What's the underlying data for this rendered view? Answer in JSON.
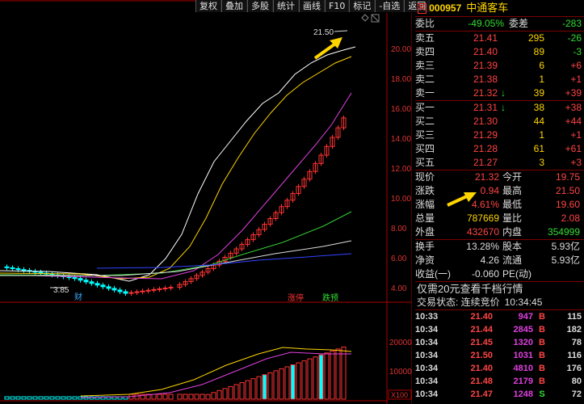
{
  "toolbar": {
    "buttons": [
      "复权",
      "叠加",
      "多股",
      "统计",
      "画线",
      "F10",
      "标记",
      "-自选",
      "返回"
    ]
  },
  "stock": {
    "badge": "R",
    "code": "000957",
    "name": "中通客车"
  },
  "chart": {
    "price_ticks": [
      "20.00",
      "18.00",
      "16.00",
      "14.00",
      "12.00",
      "10.00",
      "8.00",
      "6.00",
      "4.00"
    ],
    "volume_ticks": [
      "20000",
      "10000"
    ],
    "volume_unit": "X100",
    "high_label": "21.50",
    "low_label": "3.85",
    "marker_cai": "财",
    "marker_zhangting": "涨停",
    "marker_diefu": "跌预"
  },
  "quote": {
    "weibi": {
      "label": "委比",
      "value": "-49.05%",
      "label2": "委差",
      "value2": "-283"
    },
    "sells": [
      {
        "label": "卖五",
        "price": "21.41",
        "vol": "295",
        "chg": "-26"
      },
      {
        "label": "卖四",
        "price": "21.40",
        "vol": "89",
        "chg": "-3"
      },
      {
        "label": "卖三",
        "price": "21.39",
        "vol": "6",
        "chg": "+6"
      },
      {
        "label": "卖二",
        "price": "21.38",
        "vol": "1",
        "chg": "+1"
      },
      {
        "label": "卖一",
        "price": "21.32",
        "vol": "39",
        "chg": "+39"
      }
    ],
    "buys": [
      {
        "label": "买一",
        "price": "21.31",
        "vol": "38",
        "chg": "+38"
      },
      {
        "label": "买二",
        "price": "21.30",
        "vol": "44",
        "chg": "+44"
      },
      {
        "label": "买三",
        "price": "21.29",
        "vol": "1",
        "chg": "+1"
      },
      {
        "label": "买四",
        "price": "21.28",
        "vol": "61",
        "chg": "+61"
      },
      {
        "label": "买五",
        "price": "21.27",
        "vol": "3",
        "chg": "+3"
      }
    ],
    "stats1": [
      {
        "l1": "现价",
        "v1": "21.32",
        "l2": "今开",
        "v2": "19.75"
      },
      {
        "l1": "涨跌",
        "v1": "0.94",
        "l2": "最高",
        "v2": "21.50"
      },
      {
        "l1": "涨幅",
        "v1": "4.61%",
        "l2": "最低",
        "v2": "19.60"
      },
      {
        "l1": "总量",
        "v1": "787669",
        "l2": "量比",
        "v2": "2.08"
      },
      {
        "l1": "外盘",
        "v1": "432670",
        "l2": "内盘",
        "v2": "354999"
      }
    ],
    "stats2": [
      {
        "l1": "换手",
        "v1": "13.28%",
        "l2": "股本",
        "v2": "5.93亿"
      },
      {
        "l1": "净资",
        "v1": "4.26",
        "l2": "流通",
        "v2": "5.93亿"
      },
      {
        "l1": "收益(一)",
        "v1": "-0.060",
        "l2": "PE(动)",
        "v2": ""
      }
    ],
    "notice": "仅需20元查看千档行情",
    "status": "交易状态: 连续竞价",
    "status_time": "10:34:45"
  },
  "ticks": [
    {
      "time": "10:33",
      "price": "21.40",
      "vol": "947",
      "side": "B",
      "n": "115"
    },
    {
      "time": "10:34",
      "price": "21.44",
      "vol": "2845",
      "side": "B",
      "n": "182"
    },
    {
      "time": "10:34",
      "price": "21.45",
      "vol": "1320",
      "side": "B",
      "n": "78"
    },
    {
      "time": "10:34",
      "price": "21.50",
      "vol": "1031",
      "side": "B",
      "n": "116"
    },
    {
      "time": "10:34",
      "price": "21.40",
      "vol": "4810",
      "side": "B",
      "n": "176"
    },
    {
      "time": "10:34",
      "price": "21.48",
      "vol": "2179",
      "side": "B",
      "n": "80"
    },
    {
      "time": "10:34",
      "price": "21.47",
      "vol": "1248",
      "side": "S",
      "n": "72"
    }
  ],
  "colors": {
    "up": "#ff3333",
    "down": "#00ffff",
    "ma5": "#ffffff",
    "ma10": "#ffd500",
    "ma20": "#e040e0",
    "ma60": "#33cc33"
  }
}
